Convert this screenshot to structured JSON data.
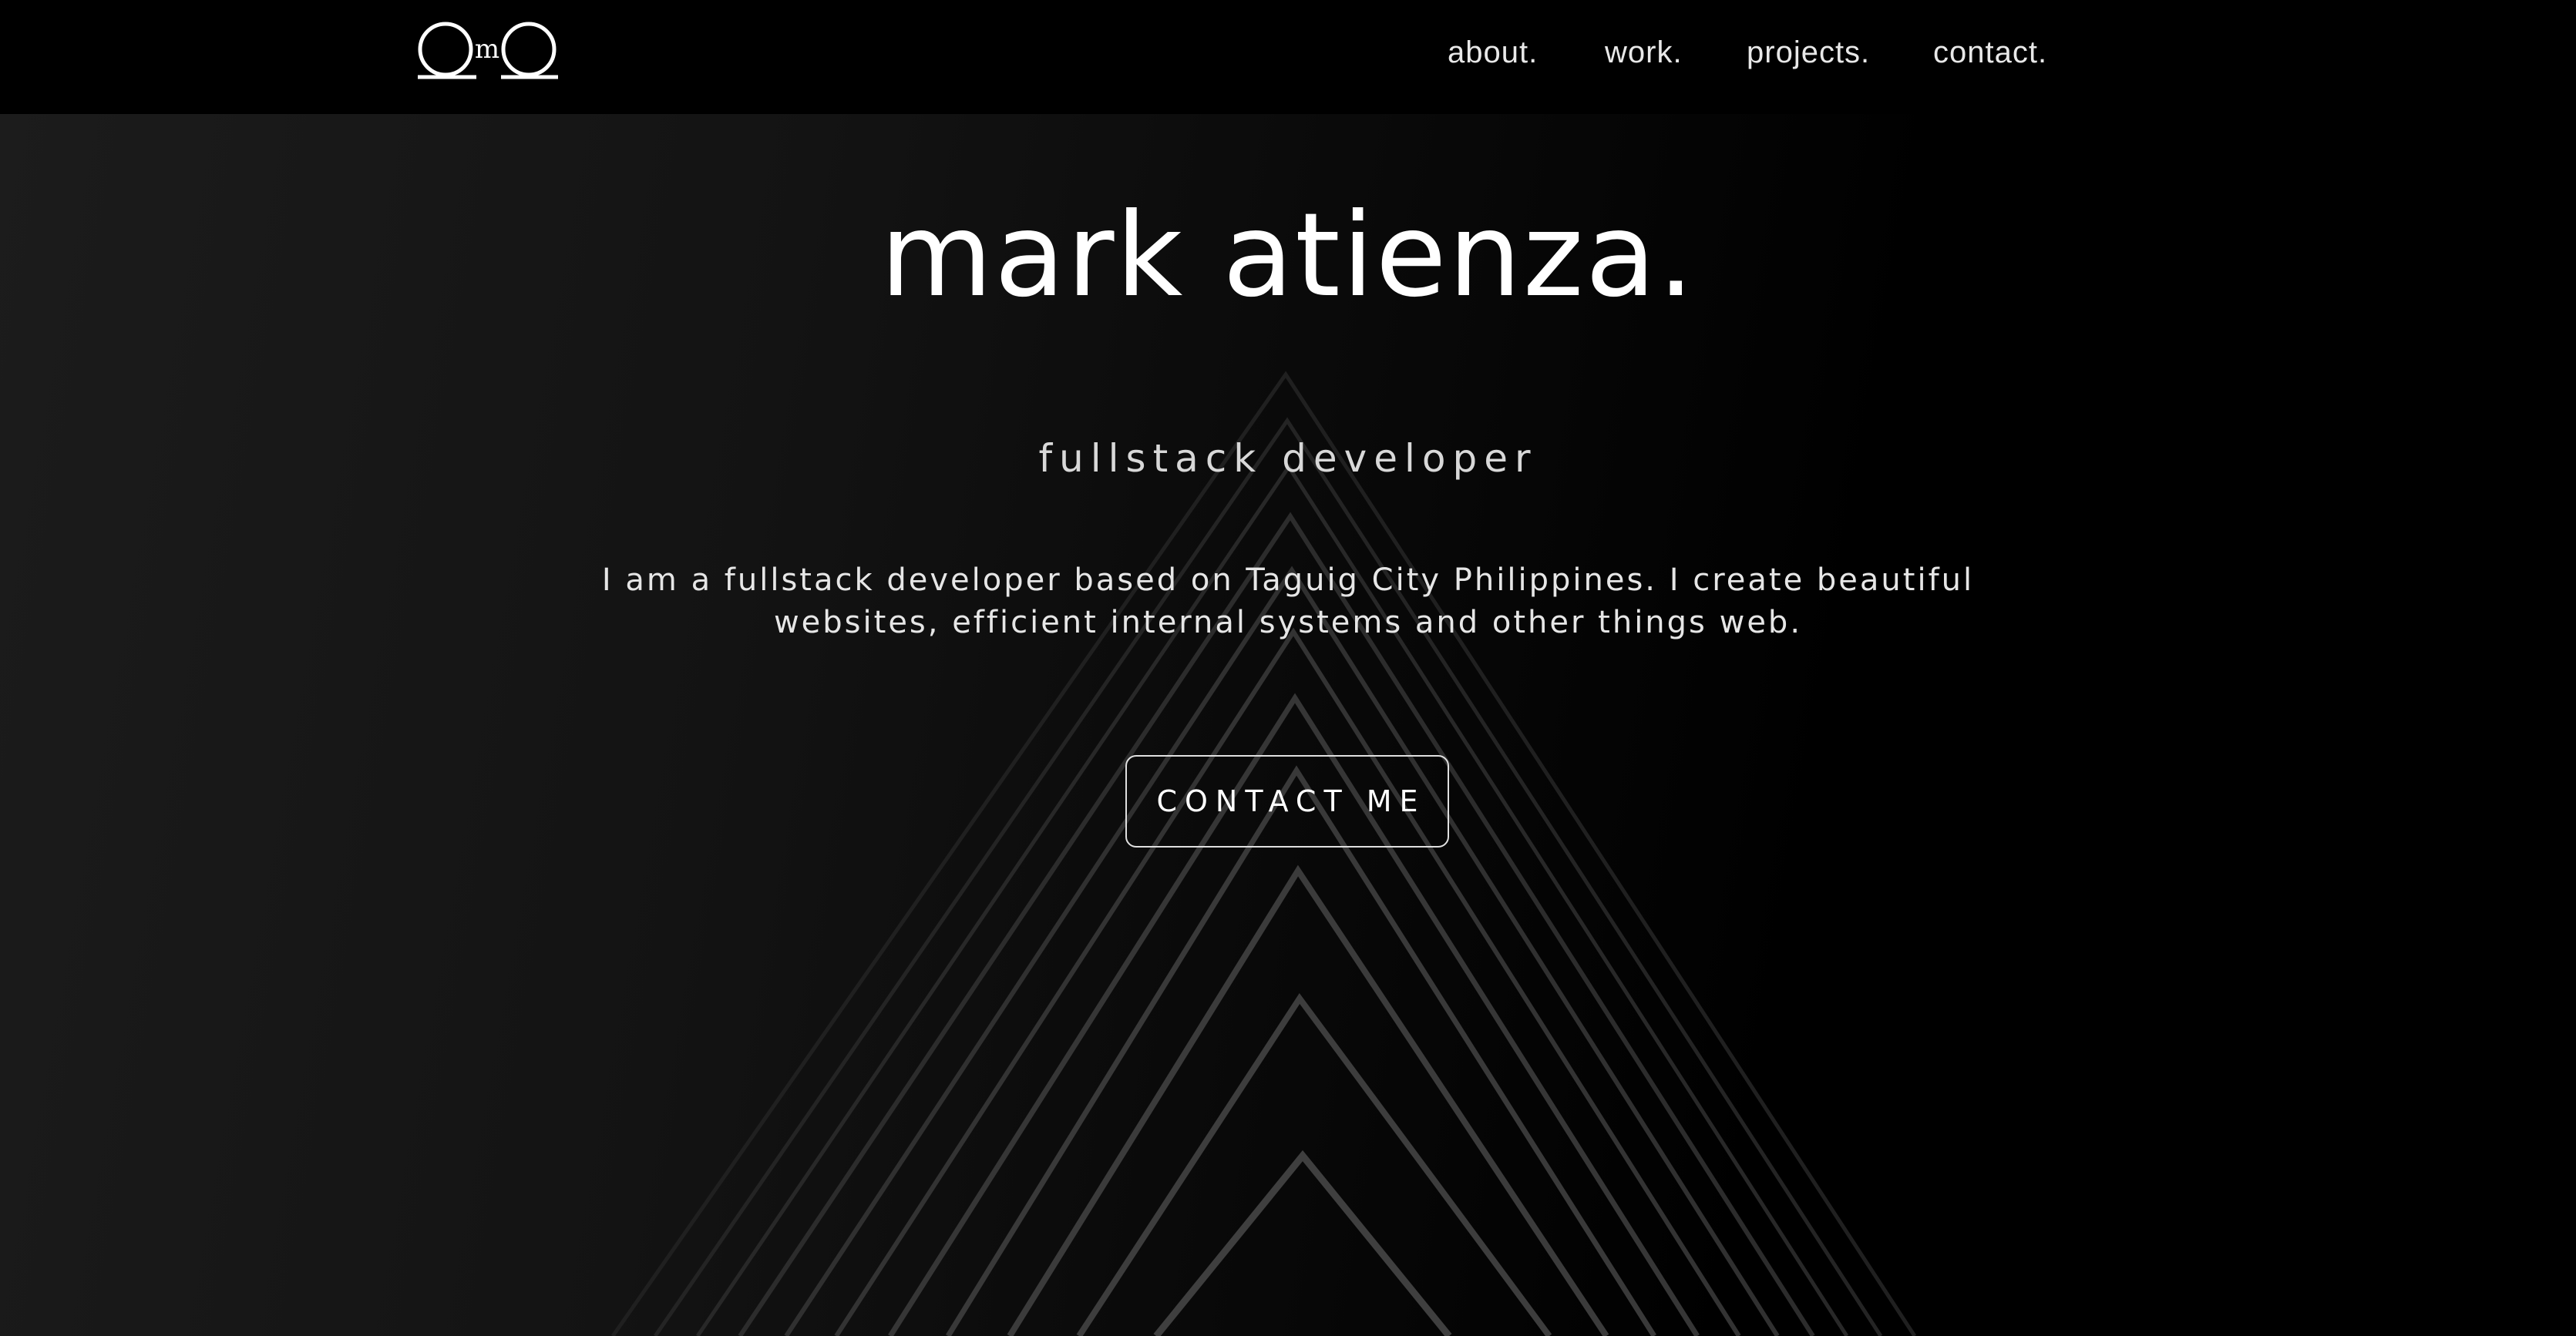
{
  "header": {
    "logo_letter": "m",
    "nav": [
      {
        "label": "about."
      },
      {
        "label": "work."
      },
      {
        "label": "projects."
      },
      {
        "label": "contact."
      }
    ]
  },
  "hero": {
    "name": "mark atienza.",
    "role": "fullstack developer",
    "bio": "I am a fullstack developer based on Taguig City Philippines. I create beautiful websites, efficient internal systems and other things web.",
    "cta_label": "CONTACT ME"
  },
  "colors": {
    "background": "#000000",
    "text": "#ffffff",
    "button_border": "#e0e0e0"
  }
}
